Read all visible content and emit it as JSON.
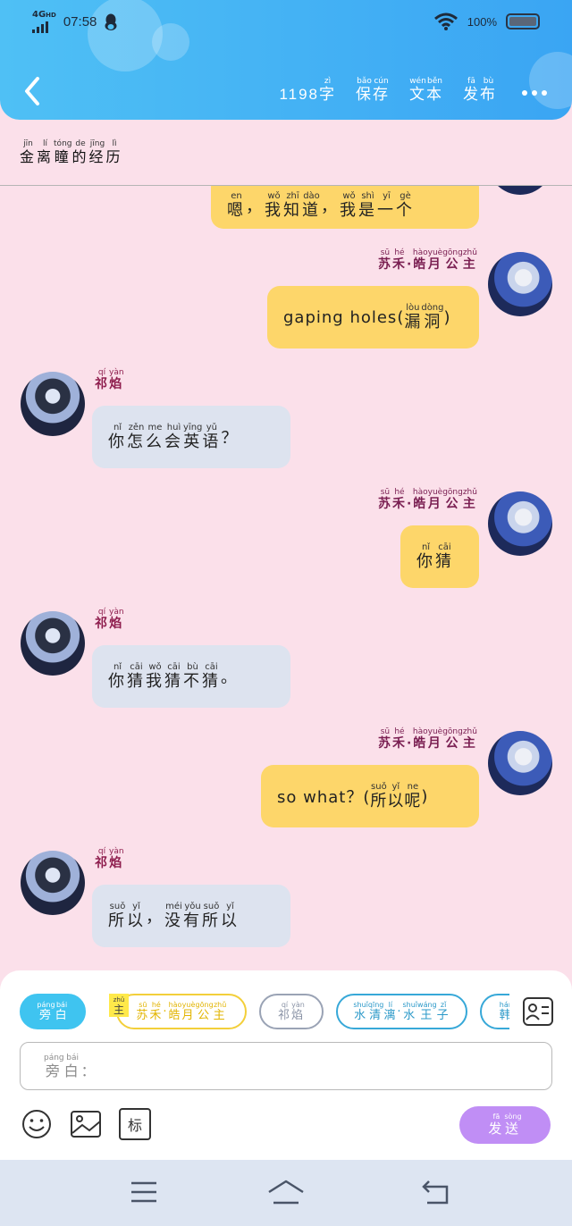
{
  "status_bar": {
    "network": "4G",
    "network_sub": "HD",
    "time": "07:58",
    "battery": "100%"
  },
  "header": {
    "word_count": "1198",
    "word_count_unit": {
      "char": "字",
      "py": "zì"
    },
    "actions": [
      {
        "chars": [
          [
            "保",
            "bǎo"
          ],
          [
            "存",
            "cún"
          ]
        ]
      },
      {
        "chars": [
          [
            "文",
            "wén"
          ],
          [
            "本",
            "běn"
          ]
        ]
      },
      {
        "chars": [
          [
            "发",
            "fā"
          ],
          [
            "布",
            "bù"
          ]
        ]
      }
    ]
  },
  "story_title": [
    [
      "金",
      "jīn"
    ],
    [
      "离",
      "lí"
    ],
    [
      "瞳",
      "tóng"
    ],
    [
      "的",
      "de"
    ],
    [
      "经",
      "jīng"
    ],
    [
      "历",
      "lì"
    ]
  ],
  "characters": {
    "princess": {
      "chars": [
        [
          "苏",
          "sū"
        ],
        [
          "禾",
          "hé"
        ],
        [
          "·",
          ""
        ],
        [
          "皓",
          "hào"
        ],
        [
          "月",
          "yuè"
        ],
        [
          "公",
          "gōng"
        ],
        [
          "主",
          "zhǔ"
        ]
      ]
    },
    "qiyan": {
      "chars": [
        [
          "祁",
          "qí"
        ],
        [
          "焰",
          "yàn"
        ]
      ]
    }
  },
  "messages": [
    {
      "side": "right",
      "chars": [
        [
          "嗯",
          "en"
        ],
        [
          "，",
          ""
        ],
        [
          "我",
          "wǒ"
        ],
        [
          "知",
          "zhī"
        ],
        [
          "道",
          "dào"
        ],
        [
          "，",
          ""
        ],
        [
          "我",
          "wǒ"
        ],
        [
          "是",
          "shì"
        ],
        [
          "一",
          "yī"
        ],
        [
          "个",
          "gè"
        ]
      ]
    },
    {
      "side": "right",
      "speaker": "princess",
      "prefix": "gaping holes(",
      "chars": [
        [
          "漏",
          "lòu"
        ],
        [
          "洞",
          "dòng"
        ]
      ],
      "suffix": ")"
    },
    {
      "side": "left",
      "speaker": "qiyan",
      "chars": [
        [
          "你",
          "nǐ"
        ],
        [
          "怎",
          "zěn"
        ],
        [
          "么",
          "me"
        ],
        [
          "会",
          "huì"
        ],
        [
          "英",
          "yīng"
        ],
        [
          "语",
          "yǔ"
        ],
        [
          "？",
          ""
        ]
      ]
    },
    {
      "side": "right",
      "speaker": "princess",
      "chars": [
        [
          "你",
          "nǐ"
        ],
        [
          "猜",
          "cāi"
        ]
      ]
    },
    {
      "side": "left",
      "speaker": "qiyan",
      "chars": [
        [
          "你",
          "nǐ"
        ],
        [
          "猜",
          "cāi"
        ],
        [
          "我",
          "wǒ"
        ],
        [
          "猜",
          "cāi"
        ],
        [
          "不",
          "bù"
        ],
        [
          "猜",
          "cāi"
        ],
        [
          "。",
          ""
        ]
      ]
    },
    {
      "side": "right",
      "speaker": "princess",
      "prefix": "so what？(",
      "chars": [
        [
          "所",
          "suǒ"
        ],
        [
          "以",
          "yǐ"
        ],
        [
          "呢",
          "ne"
        ]
      ],
      "suffix": ")"
    },
    {
      "side": "left",
      "speaker": "qiyan",
      "chars": [
        [
          "所",
          "suǒ"
        ],
        [
          "以",
          "yǐ"
        ],
        [
          "，",
          ""
        ],
        [
          "没",
          "méi"
        ],
        [
          "有",
          "yǒu"
        ],
        [
          "所",
          "suǒ"
        ],
        [
          "以",
          "yǐ"
        ]
      ]
    }
  ],
  "role_bar": {
    "tag": {
      "char": "主",
      "py": "zhǔ"
    },
    "roles": [
      {
        "chars": [
          [
            "旁",
            "páng"
          ],
          [
            "白",
            "bái"
          ]
        ],
        "color": "#3fc4f0",
        "active": true
      },
      {
        "chars": [
          [
            "苏",
            "sū"
          ],
          [
            "禾",
            "hé"
          ],
          [
            "·",
            ""
          ],
          [
            "皓",
            "hào"
          ],
          [
            "月",
            "yuè"
          ],
          [
            "公",
            "gōng"
          ],
          [
            "主",
            "zhǔ"
          ]
        ],
        "color": "#f3cf3a",
        "text_color": "#e2b400"
      },
      {
        "chars": [
          [
            "祁",
            "qí"
          ],
          [
            "焰",
            "yàn"
          ]
        ],
        "color": "#9aa3b5",
        "text_color": "#8a93a6"
      },
      {
        "chars": [
          [
            "水",
            "shuǐ"
          ],
          [
            "清",
            "qīng"
          ],
          [
            "漓",
            "lí"
          ],
          [
            "·",
            ""
          ],
          [
            "水",
            "shuǐ"
          ],
          [
            "王",
            "wáng"
          ],
          [
            "子",
            "zǐ"
          ]
        ],
        "color": "#37a8d8",
        "text_color": "#2a98c8"
      },
      {
        "chars": [
          [
            "韩",
            "hán"
          ],
          [
            "冰",
            "bīng"
          ]
        ],
        "color": "#37a8d8",
        "text_color": "#2a98c8"
      }
    ]
  },
  "composer": {
    "placeholder_chars": [
      [
        "旁",
        "páng"
      ],
      [
        "白",
        "bái"
      ]
    ],
    "placeholder_suffix": "：",
    "tag_tool": "标",
    "send_chars": [
      [
        "发",
        "fā"
      ],
      [
        "送",
        "sòng"
      ]
    ]
  },
  "colors": {
    "header": "#3aa5f3",
    "background": "#fbe0ea",
    "bubble_right": "#fdd66a",
    "bubble_left": "#dde3ef",
    "send_button": "#c08ef5",
    "name_color": "#8e1d4d"
  }
}
